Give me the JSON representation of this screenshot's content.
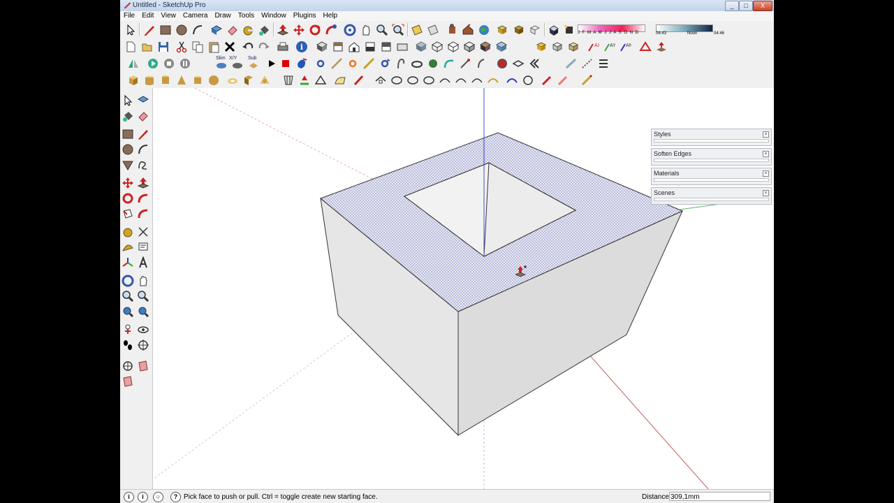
{
  "window": {
    "title": "Untitled - SketchUp Pro",
    "min": "_",
    "max": "□",
    "close": "X"
  },
  "menu": [
    "File",
    "Edit",
    "View",
    "Camera",
    "Draw",
    "Tools",
    "Window",
    "Plugins",
    "Help"
  ],
  "toolbar_labels": {
    "skin": "Skin",
    "xy": "X/Y",
    "sub": "Sub"
  },
  "shadow_settings": {
    "months": "J F M A M J J A S O N D",
    "time_start": "06:43",
    "noon": "Noon",
    "time_end": "04:46"
  },
  "trays": [
    {
      "title": "Styles"
    },
    {
      "title": "Soften Edges"
    },
    {
      "title": "Materials"
    },
    {
      "title": "Scenes"
    }
  ],
  "status": {
    "message": "Pick face to push or pull.  Ctrl = toggle create new starting face.",
    "distance_label": "Distance",
    "distance_value": "309,1mm"
  },
  "colors": {
    "red_axis": "#c03030",
    "green_axis": "#30a030",
    "blue_axis": "#3040d0",
    "face": "#e6e6e6",
    "selected_face": "#aab0d8"
  },
  "icons": [
    "select-icon",
    "pencil-icon",
    "rectangle-icon",
    "circle-icon",
    "arc-icon",
    "eraser-icon",
    "paint-bucket-icon",
    "push-pull-icon",
    "move-icon",
    "rotate-icon",
    "orbit-icon",
    "pan-icon",
    "zoom-icon",
    "zoom-extents-icon",
    "tape-measure-icon",
    "protractor-icon",
    "walk-icon",
    "look-around-icon",
    "section-plane-icon"
  ]
}
